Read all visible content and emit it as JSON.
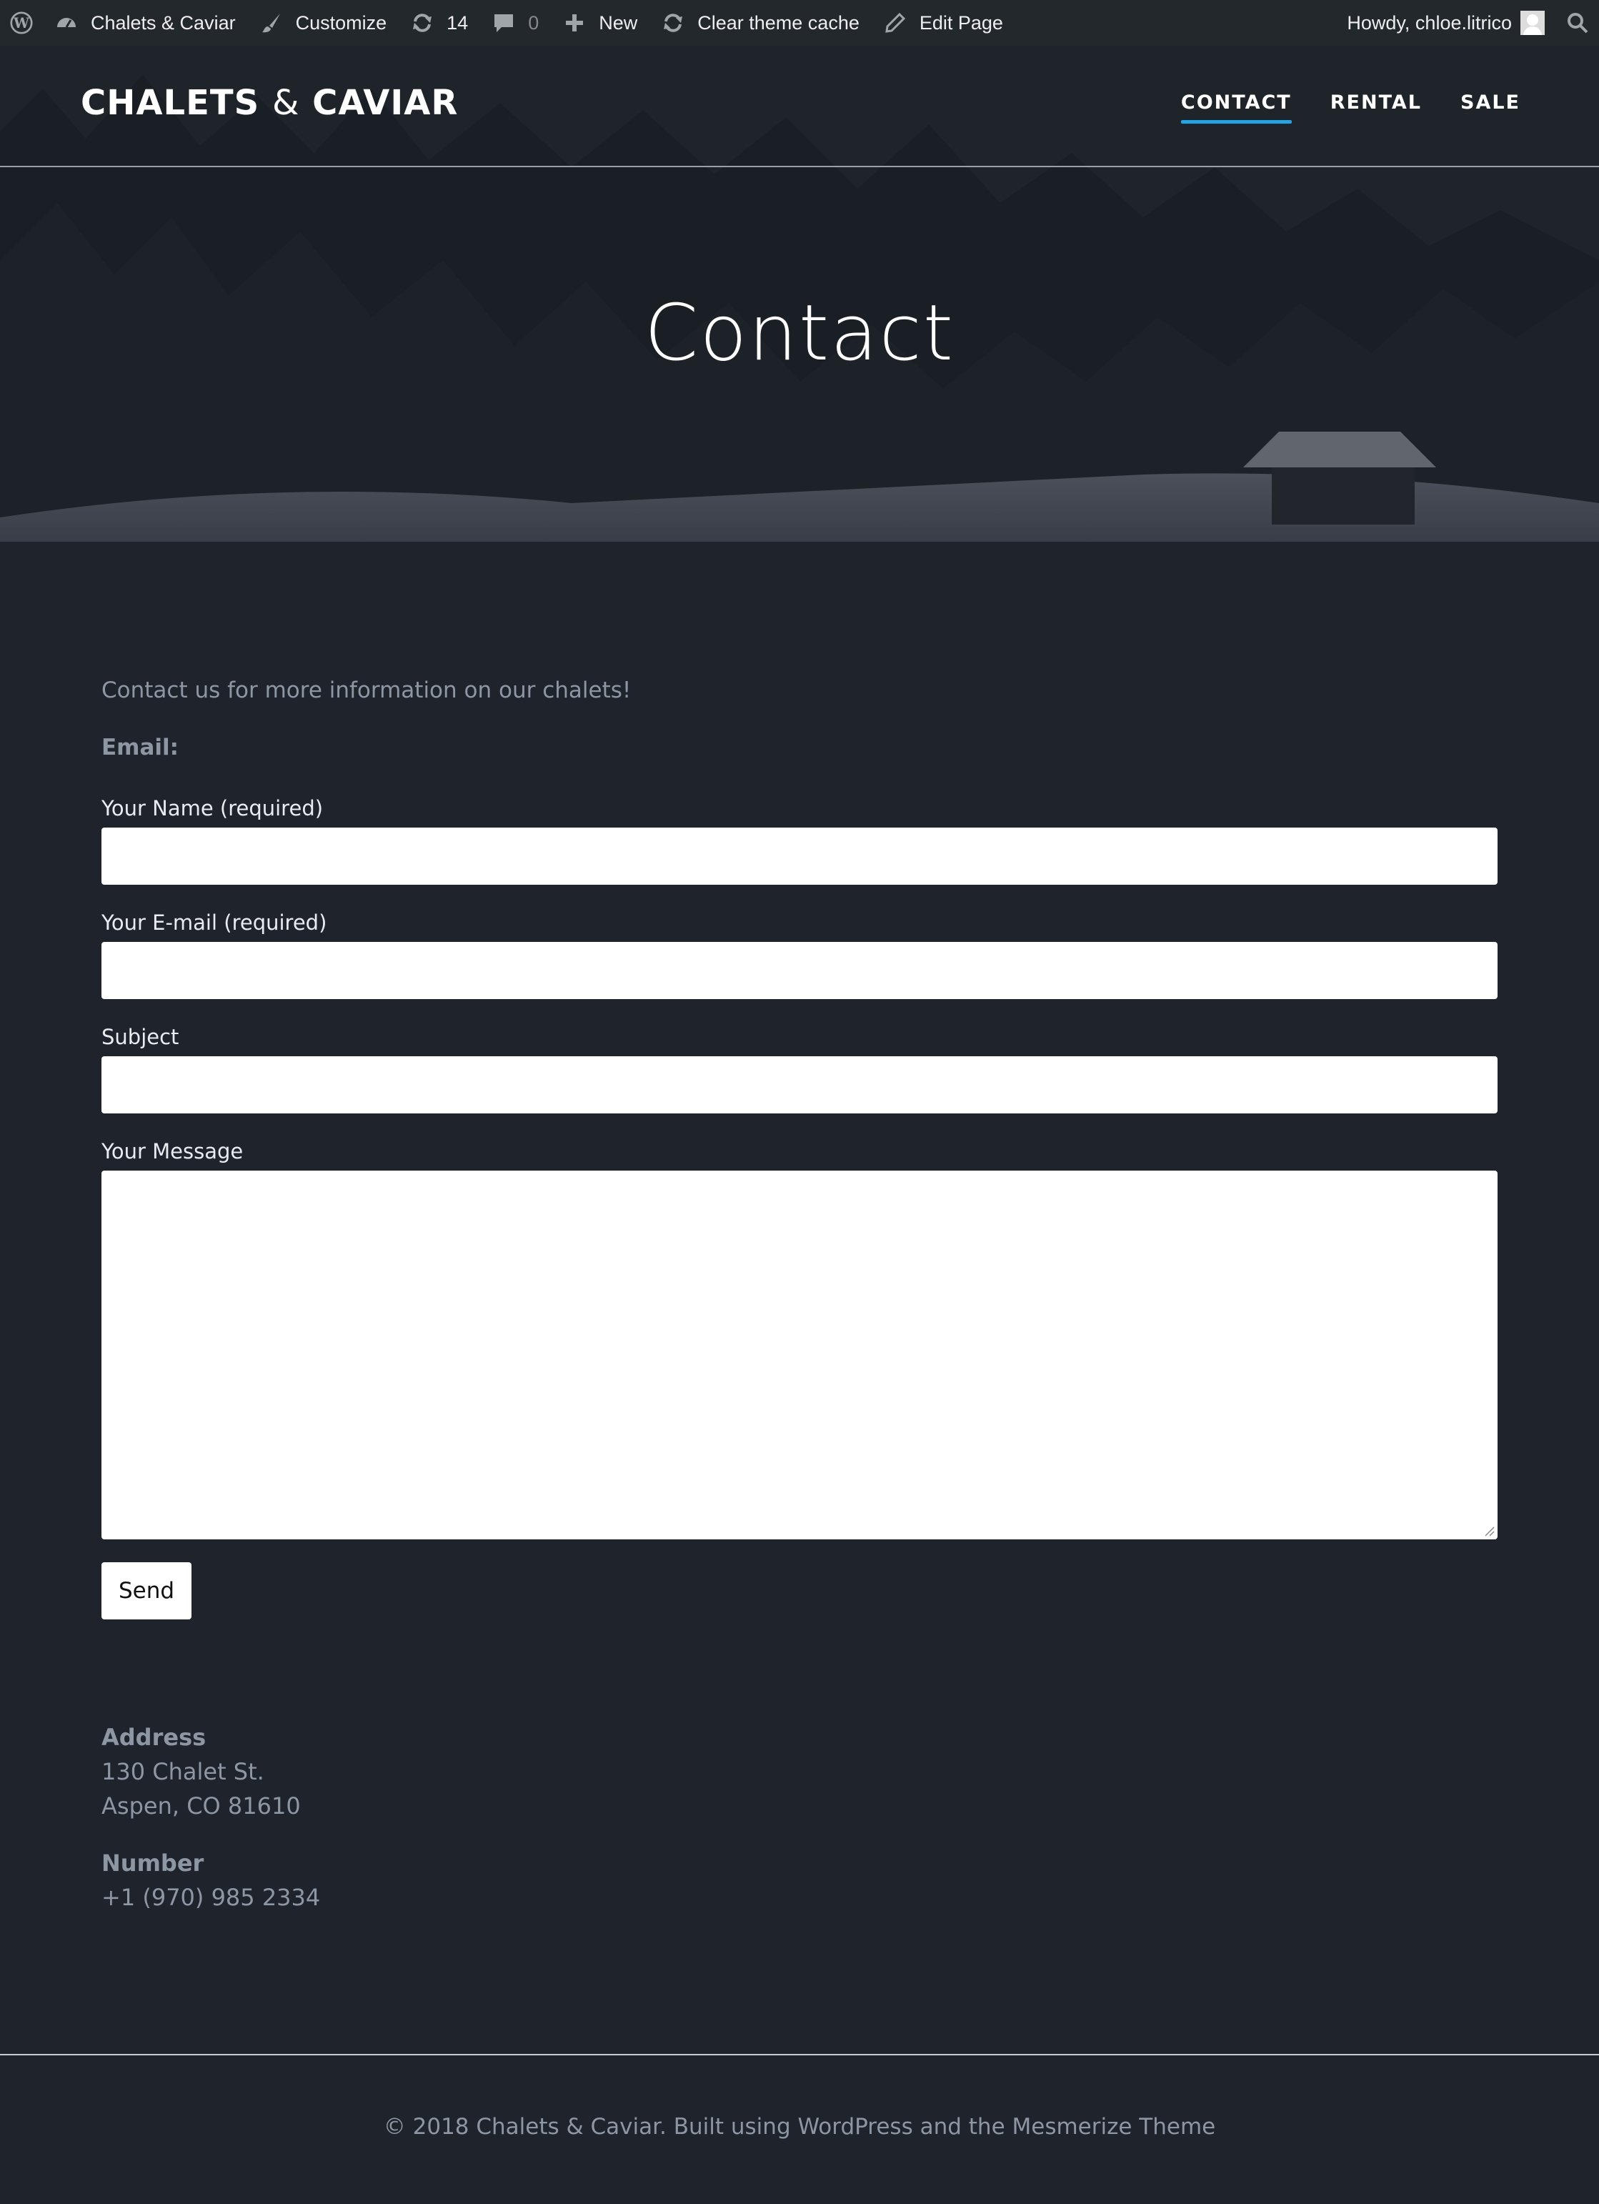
{
  "admin_bar": {
    "site_name": "Chalets & Caviar",
    "customize": "Customize",
    "updates_count": "14",
    "comments_count": "0",
    "new_label": "New",
    "clear_cache": "Clear theme cache",
    "edit_page": "Edit Page",
    "howdy": "Howdy, chloe.litrico"
  },
  "header": {
    "brand_part1": "CHALETS ",
    "brand_amp": "&",
    "brand_part2": " CAVIAR",
    "nav": [
      "CONTACT",
      "RENTAL",
      "SALE"
    ],
    "active_nav": "CONTACT",
    "hero_title": "Contact"
  },
  "content": {
    "intro": "Contact us for more information on our chalets!",
    "email_label": "Email:",
    "form": {
      "name_label": "Your Name (required)",
      "email_label": "Your E-mail (required)",
      "subject_label": "Subject",
      "message_label": "Your Message",
      "send_label": "Send"
    },
    "address_heading": "Address",
    "address_line1": "130 Chalet St.",
    "address_line2": "Aspen, CO 81610",
    "number_heading": "Number",
    "number": "+1 (970) 985 2334"
  },
  "footer": {
    "text": "©  2018 Chalets & Caviar. Built using WordPress and the Mesmerize Theme"
  },
  "colors": {
    "background": "#1f242c",
    "admin_bar": "#23282d",
    "accent": "#1ea6e6",
    "muted_text": "#8d97a3"
  },
  "icons": [
    "wordpress-icon",
    "dashboard-icon",
    "brush-icon",
    "updates-icon",
    "comment-icon",
    "plus-icon",
    "refresh-icon",
    "pencil-icon",
    "search-icon"
  ]
}
